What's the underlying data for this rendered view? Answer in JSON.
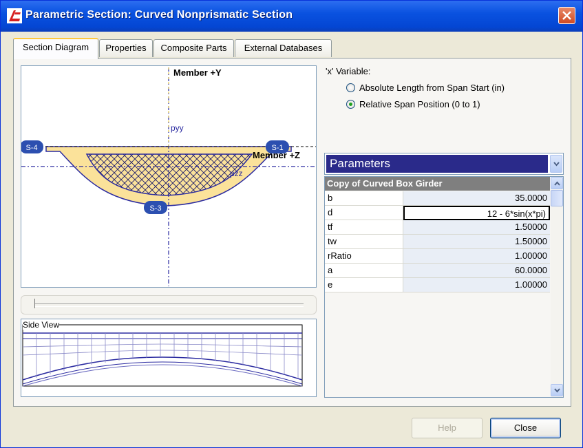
{
  "window": {
    "title": "Parametric Section: Curved Nonprismatic Section"
  },
  "tabs": [
    {
      "label": "Section Diagram",
      "active": true
    },
    {
      "label": "Properties",
      "active": false
    },
    {
      "label": "Composite Parts",
      "active": false
    },
    {
      "label": "External Databases",
      "active": false
    }
  ],
  "diagram": {
    "axis_y_label": "Member +Y",
    "axis_z_label": "Member +Z",
    "pyy_label": "pyy",
    "pzz_label": "pzz",
    "points": [
      "S-4",
      "S-1",
      "S-3"
    ],
    "fill_color": "#fbe29a",
    "outline_color": "#2a2aa0"
  },
  "slider": {
    "position": 0
  },
  "side_view": {
    "label": "Side View"
  },
  "x_variable": {
    "label": "'x' Variable:",
    "options": [
      {
        "label": "Absolute Length from Span Start (in)",
        "checked": false
      },
      {
        "label": "Relative Span Position (0 to 1)",
        "checked": true
      }
    ]
  },
  "parameters": {
    "combo_label": "Parameters",
    "group_title": "Copy of Curved Box Girder",
    "rows": [
      {
        "name": "b",
        "value": "35.0000"
      },
      {
        "name": "d",
        "value": "12 - 6*sin(x*pi)",
        "editing": true
      },
      {
        "name": "tf",
        "value": "1.50000"
      },
      {
        "name": "tw",
        "value": "1.50000"
      },
      {
        "name": "rRatio",
        "value": "1.00000"
      },
      {
        "name": "a",
        "value": "60.0000"
      },
      {
        "name": "e",
        "value": "1.00000"
      }
    ]
  },
  "buttons": {
    "help": "Help",
    "close": "Close"
  },
  "colors": {
    "title_bar": "#0a52e0",
    "selection": "#2a2a8a"
  }
}
